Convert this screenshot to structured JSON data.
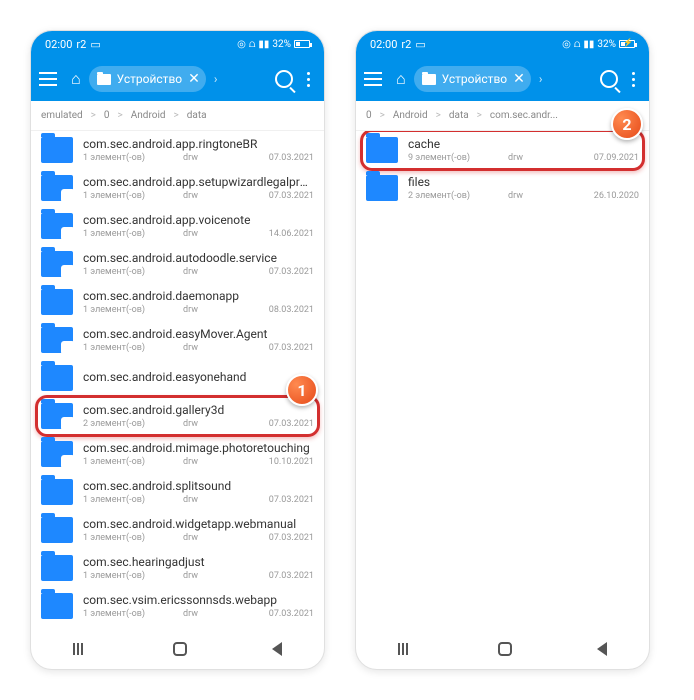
{
  "status": {
    "time": "02:00",
    "network_label": "r2",
    "battery_pct_left": "32%",
    "battery_pct_right": "32%"
  },
  "toolbar": {
    "path_chip": "Устройство"
  },
  "left": {
    "breadcrumb": [
      "emulated",
      "0",
      "Android",
      "data"
    ],
    "items": [
      {
        "name": "com.sec.android.app.ringtoneBR",
        "count": "1 элемент(-ов)",
        "perm": "drw",
        "date": "07.03.2021",
        "overlay": false
      },
      {
        "name": "com.sec.android.app.setupwizardlegalprovider",
        "count": "1 элемент(-ов)",
        "perm": "drw",
        "date": "07.03.2021",
        "overlay": true
      },
      {
        "name": "com.sec.android.app.voicenote",
        "count": "1 элемент(-ов)",
        "perm": "drw",
        "date": "14.06.2021",
        "overlay": true
      },
      {
        "name": "com.sec.android.autodoodle.service",
        "count": "1 элемент(-ов)",
        "perm": "drw",
        "date": "07.03.2021",
        "overlay": true
      },
      {
        "name": "com.sec.android.daemonapp",
        "count": "1 элемент(-ов)",
        "perm": "drw",
        "date": "08.03.2021",
        "overlay": false
      },
      {
        "name": "com.sec.android.easyMover.Agent",
        "count": "1 элемент(-ов)",
        "perm": "drw",
        "date": "07.03.2021",
        "overlay": true
      },
      {
        "name": "com.sec.android.easyonehand",
        "count": "",
        "perm": "",
        "date": "",
        "overlay": false
      },
      {
        "name": "com.sec.android.gallery3d",
        "count": "2 элемент(-ов)",
        "perm": "drw",
        "date": "07.03.2021",
        "overlay": true
      },
      {
        "name": "com.sec.android.mimage.photoretouching",
        "count": "1 элемент(-ов)",
        "perm": "drw",
        "date": "10.10.2021",
        "overlay": true
      },
      {
        "name": "com.sec.android.splitsound",
        "count": "1 элемент(-ов)",
        "perm": "drw",
        "date": "07.03.2021",
        "overlay": false
      },
      {
        "name": "com.sec.android.widgetapp.webmanual",
        "count": "1 элемент(-ов)",
        "perm": "drw",
        "date": "07.03.2021",
        "overlay": false
      },
      {
        "name": "com.sec.hearingadjust",
        "count": "1 элемент(-ов)",
        "perm": "drw",
        "date": "07.03.2021",
        "overlay": false
      },
      {
        "name": "com.sec.vsim.ericssonnsds.webapp",
        "count": "1 элемент(-ов)",
        "perm": "drw",
        "date": "07.03.2021",
        "overlay": false
      }
    ],
    "highlight_index": 7,
    "callout_label": "1"
  },
  "right": {
    "breadcrumb": [
      "0",
      "Android",
      "data",
      "com.sec.andr..."
    ],
    "items": [
      {
        "name": "cache",
        "count": "9 элемент(-ов)",
        "perm": "drw",
        "date": "07.09.2021",
        "overlay": false
      },
      {
        "name": "files",
        "count": "2 элемент(-ов)",
        "perm": "drw",
        "date": "26.10.2020",
        "overlay": false
      }
    ],
    "highlight_index": 0,
    "callout_label": "2"
  }
}
